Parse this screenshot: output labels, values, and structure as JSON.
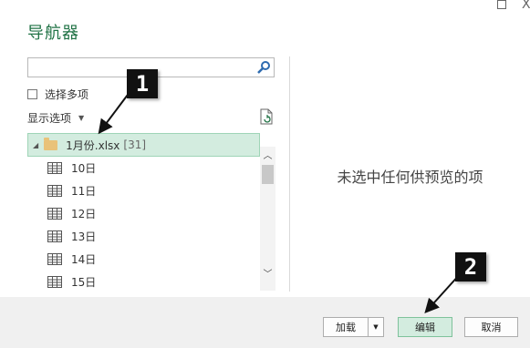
{
  "window": {
    "title": "导航器",
    "maximize_glyph": "□",
    "close_glyph": "X"
  },
  "search": {
    "placeholder": "",
    "value": ""
  },
  "options": {
    "select_multiple_label": "选择多项",
    "select_multiple_checked": false,
    "display_options_label": "显示选项"
  },
  "tree": {
    "root": {
      "label": "1月份.xlsx",
      "count": "[31]"
    },
    "items": [
      {
        "label": "10日"
      },
      {
        "label": "11日"
      },
      {
        "label": "12日"
      },
      {
        "label": "13日"
      },
      {
        "label": "14日"
      },
      {
        "label": "15日"
      }
    ]
  },
  "preview": {
    "empty_message": "未选中任何供预览的项"
  },
  "footer": {
    "load_label": "加载",
    "edit_label": "编辑",
    "cancel_label": "取消"
  },
  "callouts": {
    "one": "1",
    "two": "2"
  },
  "colors": {
    "title_green": "#217346",
    "selection_bg": "#d3ecdf",
    "selection_border": "#9fd5b7",
    "folder": "#e9c27a"
  }
}
